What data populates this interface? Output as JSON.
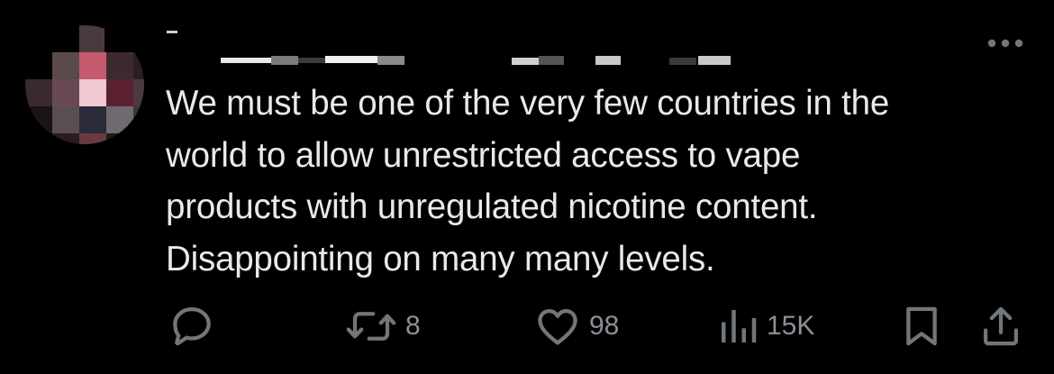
{
  "tweet": {
    "text_lines": [
      "We must be one of the very few countries in the",
      "world to allow unrestricted access to vape",
      "products with unregulated nicotine content.",
      "Disappointing on many many levels."
    ]
  },
  "actions": {
    "reply": {
      "icon": "reply-icon"
    },
    "retweet": {
      "icon": "retweet-icon",
      "count": "8"
    },
    "like": {
      "icon": "heart-icon",
      "count": "98"
    },
    "views": {
      "icon": "bar-chart-icon",
      "count": "15K"
    },
    "bookmark": {
      "icon": "bookmark-icon"
    },
    "share": {
      "icon": "share-icon"
    }
  },
  "colors": {
    "background": "#000000",
    "text": "#e7e9ea",
    "icon": "#71767b"
  }
}
